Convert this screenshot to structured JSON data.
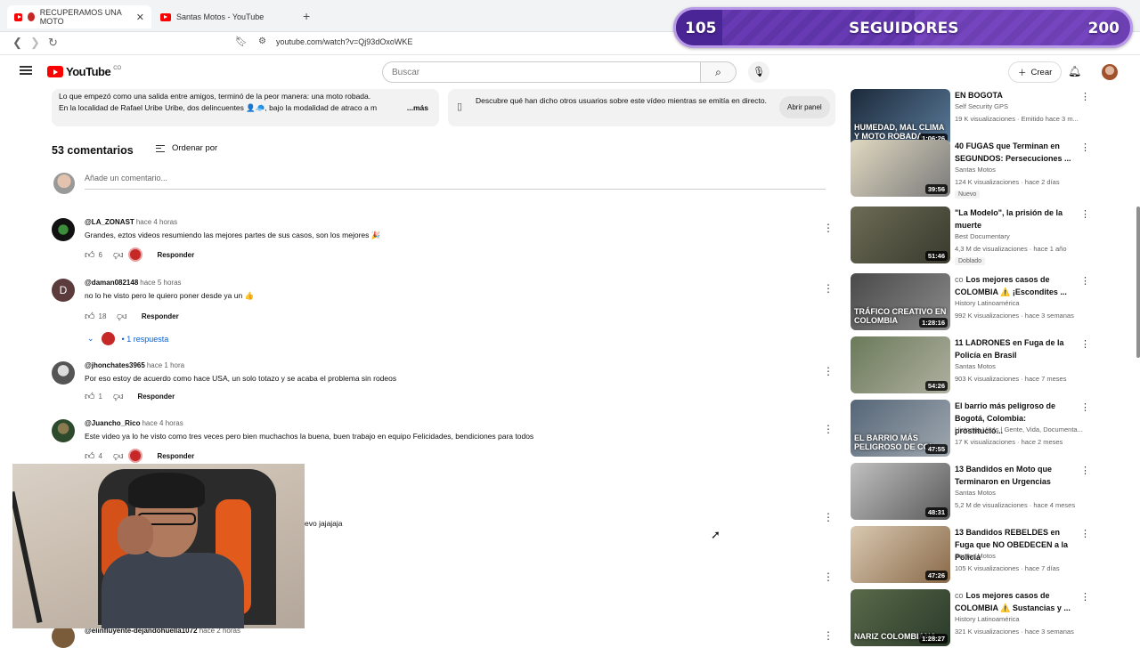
{
  "browser": {
    "tabs": [
      {
        "title": "RECUPERAMOS UNA MOTO",
        "active": true
      },
      {
        "title": "Santas Motos - YouTube",
        "active": false
      }
    ],
    "url": "youtube.com/watch?v=Qj93dOxoWKE"
  },
  "overlay": {
    "left_count": "105",
    "label": "SEGUIDORES",
    "goal": "200",
    "progress": 0.525,
    "color": "#6c3fb3"
  },
  "header": {
    "logo": "YouTube",
    "logo_region": "CO",
    "search_placeholder": "Buscar",
    "create_label": "Crear"
  },
  "description": {
    "line1": "Lo que empezó como una salida entre amigos, terminó de la peor manera: una moto robada.",
    "line2": "En la localidad de Rafael Uribe Uribe, dos delincuentes 👤🧢, bajo la modalidad de atraco a m",
    "more": "...más"
  },
  "chat_panel": {
    "text": "Descubre qué han dicho otros usuarios sobre este vídeo mientras se emitía en directo.",
    "button": "Abrir panel"
  },
  "comments": {
    "count": "53 comentarios",
    "sort_label": "Ordenar por",
    "add_placeholder": "Añade un comentario...",
    "reply_label": "Responder",
    "items": [
      {
        "user": "@LA_ZONAST",
        "time": "hace 4 horas",
        "text": "Grandes, eztos videos resumiendo las mejores partes de sus casos, son los mejores 🎉",
        "likes": "6",
        "hearted": true
      },
      {
        "user": "@daman082148",
        "time": "hace 5 horas",
        "text": "no lo he visto pero le quiero poner desde ya un 👍",
        "likes": "18",
        "hearted": false
      },
      {
        "user": "@jhonchates3965",
        "time": "hace 1 hora",
        "text": "Por eso estoy de acuerdo como hace USA, un solo totazo y se acaba el problema sin rodeos",
        "likes": "1",
        "hearted": false
      },
      {
        "user": "@Juancho_Rico",
        "time": "hace 4 horas",
        "text": "Este video ya lo he visto como tres veces pero bien muchachos la buena, buen trabajo en equipo Felicidades, bendiciones para todos",
        "likes": "4",
        "hearted": true
      }
    ],
    "replies_label": "1 respuesta",
    "partial_text": "evo jajajaja",
    "last_user": "@elinfluyente-dejandohuella1072",
    "last_time": "hace 2 horas"
  },
  "sidebar": {
    "videos": [
      {
        "title": "EN BOGOTA",
        "channel": "Self Security GPS",
        "meta": "19 K visualizaciones · Emitido hace 3 m...",
        "duration": "1:06:26",
        "thumb_caption": "HUMEDAD, MAL CLIMA Y MOTO ROBADA"
      },
      {
        "title": "40 FUGAS que Terminan en SEGUNDOS: Persecuciones ...",
        "channel": "Santas Motos",
        "meta": "124 K visualizaciones · hace 2 días",
        "badge": "Nuevo",
        "duration": "39:56",
        "thumb_caption": ""
      },
      {
        "title": "\"La Modelo\", la prisión de la muerte",
        "channel": "Best Documentary",
        "meta": "4,3 M de visualizaciones · hace 1 año",
        "badge": "Doblado",
        "duration": "51:46",
        "thumb_caption": ""
      },
      {
        "title": "Los mejores casos de COLOMBIA ⚠️ ¡Escondites ...",
        "prefix": "co",
        "channel": "History Latinoamérica",
        "meta": "992 K visualizaciones · hace 3 semanas",
        "duration": "1:28:16",
        "thumb_caption": "TRÁFICO CREATIVO EN COLOMBIA"
      },
      {
        "title": "11 LADRONES en Fuga de la Policía en Brasil",
        "channel": "Santas Motos",
        "meta": "903 K visualizaciones · hace 7 meses",
        "duration": "54:26",
        "thumb_caption": ""
      },
      {
        "title": "El barrio más peligroso de Bogotá, Colombia: prostitució...",
        "channel": "Historias Vivas | Gente, Vida, Documenta...",
        "meta": "17 K visualizaciones · hace 2 meses",
        "duration": "47:55",
        "thumb_caption": "EL BARRIO MÁS PELIGROSO DE COL"
      },
      {
        "title": "13 Bandidos en Moto que Terminaron en Urgencias",
        "channel": "Santas Motos",
        "meta": "5,2 M de visualizaciones · hace 4 meses",
        "duration": "48:31",
        "thumb_caption": ""
      },
      {
        "title": "13 Bandidos REBELDES en Fuga que NO OBEDECEN a la Policía",
        "channel": "Santas Motos",
        "meta": "105 K visualizaciones · hace 7 días",
        "duration": "47:26",
        "thumb_caption": ""
      },
      {
        "title": "Los mejores casos de COLOMBIA ⚠️ Sustancias y ...",
        "prefix": "co",
        "channel": "History Latinoamérica",
        "meta": "321 K visualizaciones · hace 3 semanas",
        "duration": "1:28:27",
        "thumb_caption": "NARIZ COLOMBIANA"
      }
    ]
  }
}
